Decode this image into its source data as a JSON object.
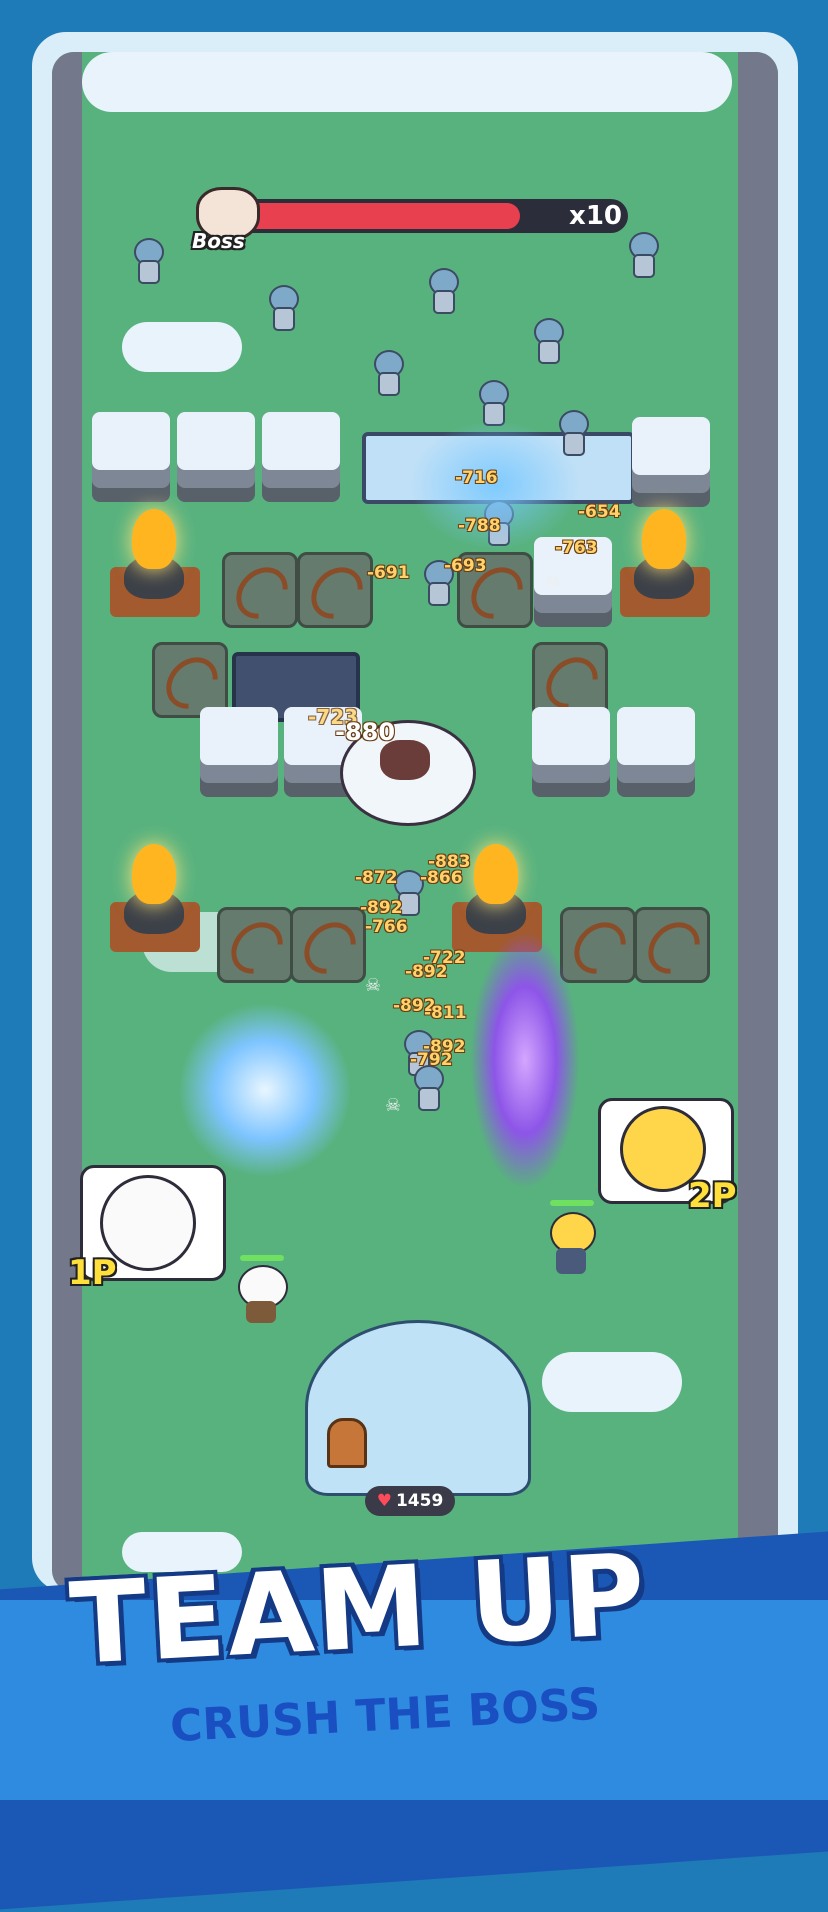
{
  "boss": {
    "label": "Boss",
    "multiplier": "x10",
    "health_fraction": 0.73
  },
  "damage_numbers": [
    "-716",
    "-654",
    "-788",
    "-763",
    "-693",
    "-691",
    "-723",
    "-880",
    "-883",
    "-872",
    "-866",
    "-892",
    "-766",
    "-722",
    "-892",
    "-892",
    "-811",
    "-892",
    "-792"
  ],
  "players": {
    "p1": {
      "tag": "1P"
    },
    "p2": {
      "tag": "2P"
    }
  },
  "base": {
    "health": "1459"
  },
  "banner": {
    "title": "TEAM UP",
    "subtitle": "CRUSH THE BOSS"
  },
  "colors": {
    "grass": "#58b27e",
    "boss_bar": "#e8404f",
    "tag_yellow": "#ffe03a",
    "banner_blue": "#1b58b6"
  }
}
